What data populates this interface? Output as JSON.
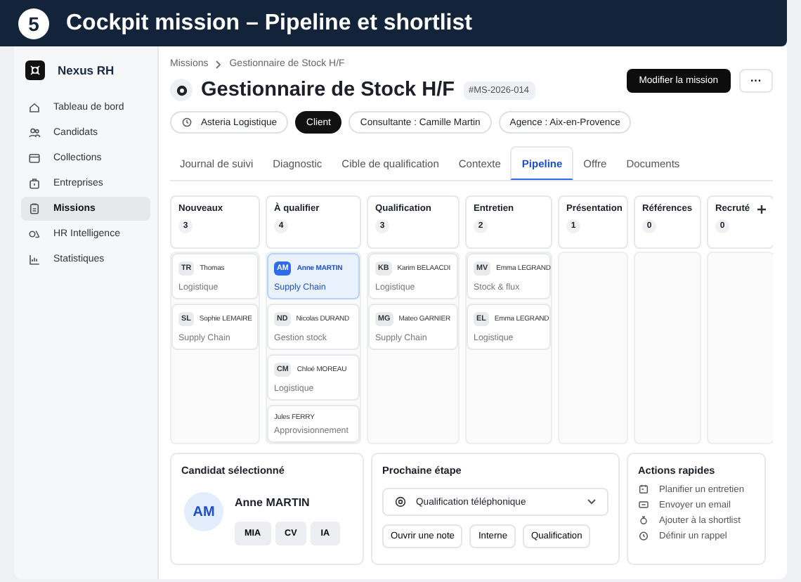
{
  "header": {
    "step": "5",
    "title": "Cockpit mission – Pipeline et shortlist"
  },
  "sidebar": {
    "brand": "Nexus RH",
    "items": [
      {
        "label": "Tableau de bord",
        "selected": false
      },
      {
        "label": "Candidats",
        "selected": false
      },
      {
        "label": "Collections",
        "selected": false
      },
      {
        "label": "Entreprises",
        "selected": false
      },
      {
        "label": "Missions",
        "selected": true
      },
      {
        "label": "HR Intelligence",
        "selected": false
      },
      {
        "label": "Statistiques",
        "selected": false
      }
    ]
  },
  "breadcrumb": [
    "Missions",
    "Gestionnaire de Stock H/F"
  ],
  "mission": {
    "title": "Gestionnaire de Stock H/F",
    "reference": "#MS-2026-014",
    "primary_button": "Modifier la mission",
    "more_button": "···"
  },
  "chips": [
    {
      "kind": "company",
      "label": "Asteria Logistique"
    },
    {
      "kind": "tag",
      "label": "Client"
    },
    {
      "kind": "plain",
      "label": "Consultante : Camille Martin"
    },
    {
      "kind": "plain",
      "label": "Agence : Aix-en-Provence"
    }
  ],
  "tabs": [
    {
      "label": "Journal de suivi",
      "selected": false
    },
    {
      "label": "Diagnostic",
      "selected": false
    },
    {
      "label": "Cible de qualification",
      "selected": false
    },
    {
      "label": "Contexte",
      "selected": false
    },
    {
      "label": "Pipeline",
      "selected": true
    },
    {
      "label": "Offre",
      "selected": false
    },
    {
      "label": "Documents",
      "selected": false
    }
  ],
  "columns": [
    {
      "title": "Nouveaux",
      "count": "3",
      "cards": [
        {
          "initials": "TR",
          "name": "Thomas",
          "subtitle": "Logistique",
          "selected": false
        },
        {
          "initials": "SL",
          "name": "Sophie LEMAIRE",
          "subtitle": "Supply Chain",
          "selected": false
        }
      ]
    },
    {
      "title": "À qualifier",
      "count": "4",
      "cards": [
        {
          "initials": "AM",
          "name": "Anne MARTIN",
          "subtitle": "Supply Chain",
          "selected": true
        },
        {
          "initials": "ND",
          "name": "Nicolas DURAND",
          "subtitle": "Gestion stock",
          "selected": false
        },
        {
          "initials": "CM",
          "name": "Chloé MOREAU",
          "subtitle": "Logistique",
          "selected": false
        },
        {
          "name": "Jules FERRY",
          "subtitle": "Approvisionnement",
          "selected": false
        }
      ]
    },
    {
      "title": "Qualification",
      "count": "3",
      "cards": [
        {
          "initials": "KB",
          "name": "Karim BELAACDI",
          "subtitle": "Logistique",
          "selected": false
        },
        {
          "initials": "MG",
          "name": "Mateo GARNIER",
          "subtitle": "Supply Chain",
          "selected": false
        }
      ]
    },
    {
      "title": "Entretien",
      "count": "2",
      "cards": [
        {
          "initials": "MV",
          "name": "Emma LEGRAND",
          "subtitle": "Stock & flux",
          "selected": false
        },
        {
          "initials": "EL",
          "name": "Emma LEGRAND",
          "subtitle": "Logistique",
          "selected": false
        }
      ]
    },
    {
      "title": "Présentation",
      "count": "1"
    },
    {
      "title": "Références",
      "count": "0"
    },
    {
      "title": "Recruté",
      "count": "0",
      "add": true
    }
  ],
  "selected_candidate": {
    "heading": "Candidat sélectionné",
    "initials": "AM",
    "name": "Anne MARTIN",
    "tags": [
      "MIA",
      "CV",
      "IA"
    ]
  },
  "next_step": {
    "heading": "Prochaine étape",
    "value": "Qualification téléphonique",
    "buttons": [
      "Ouvrir une note",
      "Interne",
      "Qualification"
    ]
  },
  "quick_actions": {
    "heading": "Actions rapides",
    "items": [
      "Planifier un entretien",
      "Envoyer un email",
      "Ajouter à la shortlist",
      "Définir un rappel"
    ]
  }
}
